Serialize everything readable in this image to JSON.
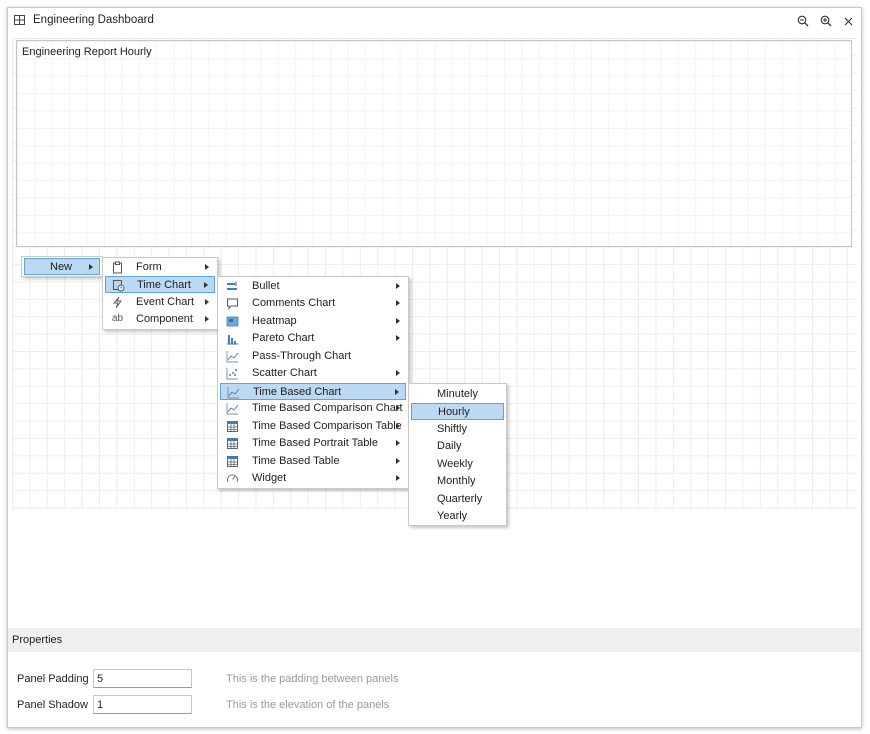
{
  "window": {
    "title": "Engineering Dashboard"
  },
  "report": {
    "title": "Engineering Report Hourly"
  },
  "menus": {
    "root": [
      {
        "label": "New",
        "has_submenu": true,
        "selected": true
      }
    ],
    "new": [
      {
        "label": "Form",
        "icon": "clipboard-icon",
        "has_submenu": true,
        "selected": false
      },
      {
        "label": "Time Chart",
        "icon": "time-chart-icon",
        "has_submenu": true,
        "selected": true
      },
      {
        "label": "Event Chart",
        "icon": "lightning-icon",
        "has_submenu": true,
        "selected": false
      },
      {
        "label": "Component",
        "icon": "ab-text-icon",
        "icon_text": "ab",
        "has_submenu": true,
        "selected": false
      }
    ],
    "time_chart": [
      {
        "label": "Bullet",
        "icon": "bullet-chart-icon",
        "has_submenu": true,
        "selected": false
      },
      {
        "label": "Comments Chart",
        "icon": "comment-icon",
        "has_submenu": true,
        "selected": false
      },
      {
        "label": "Heatmap",
        "icon": "heatmap-icon",
        "has_submenu": true,
        "selected": false
      },
      {
        "label": "Pareto Chart",
        "icon": "pareto-chart-icon",
        "has_submenu": true,
        "selected": false
      },
      {
        "label": "Pass-Through Chart",
        "icon": "line-chart-icon",
        "has_submenu": false,
        "selected": false
      },
      {
        "label": "Scatter Chart",
        "icon": "scatter-chart-icon",
        "has_submenu": true,
        "selected": false
      },
      {
        "label": "Time Based Chart",
        "icon": "line-chart-icon",
        "has_submenu": true,
        "selected": true
      },
      {
        "label": "Time Based Comparison Chart",
        "icon": "line-chart-icon",
        "has_submenu": true,
        "selected": false
      },
      {
        "label": "Time Based Comparison Table",
        "icon": "table-icon",
        "has_submenu": true,
        "selected": false
      },
      {
        "label": "Time Based Portrait Table",
        "icon": "table-icon",
        "has_submenu": true,
        "selected": false
      },
      {
        "label": "Time Based Table",
        "icon": "table-icon",
        "has_submenu": true,
        "selected": false
      },
      {
        "label": "Widget",
        "icon": "gauge-icon",
        "has_submenu": true,
        "selected": false
      }
    ],
    "time_based_chart": [
      {
        "label": "Minutely",
        "selected": false
      },
      {
        "label": "Hourly",
        "selected": true
      },
      {
        "label": "Shiftly",
        "selected": false
      },
      {
        "label": "Daily",
        "selected": false
      },
      {
        "label": "Weekly",
        "selected": false
      },
      {
        "label": "Monthly",
        "selected": false
      },
      {
        "label": "Quarterly",
        "selected": false
      },
      {
        "label": "Yearly",
        "selected": false
      }
    ]
  },
  "properties": {
    "title": "Properties",
    "fields": [
      {
        "label": "Panel Padding",
        "value": "5",
        "description": "This is the padding between panels"
      },
      {
        "label": "Panel Shadow",
        "value": "1",
        "description": "This is the elevation of the panels"
      }
    ]
  },
  "colors": {
    "selection": "#bcd9f3",
    "selection_border": "#5fa4dc",
    "icon_blue": "#3b82c4"
  }
}
